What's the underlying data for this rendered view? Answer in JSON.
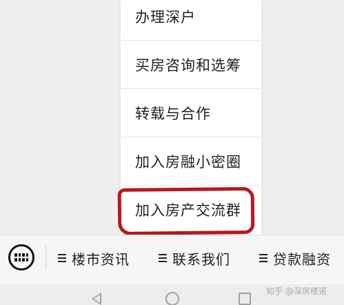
{
  "menu": {
    "items": [
      {
        "label": "办理深户"
      },
      {
        "label": "买房咨询和选筹"
      },
      {
        "label": "转载与合作"
      },
      {
        "label": "加入房融小密圈"
      },
      {
        "label": "加入房产交流群",
        "highlighted": true
      }
    ],
    "highlight_color": "#b7191b"
  },
  "bottom_bar": {
    "keyboard_icon": "keyboard-icon",
    "tabs": [
      {
        "label": "楼市资讯",
        "icon": "menu-lines-icon"
      },
      {
        "label": "联系我们",
        "icon": "menu-lines-icon"
      },
      {
        "label": "贷款融资",
        "icon": "menu-lines-icon"
      }
    ]
  },
  "watermark": "知乎 @深房楼诺",
  "system_nav": {
    "back_icon": "back-triangle-icon",
    "home_icon": "home-circle-icon",
    "recent_icon": "recent-square-icon"
  }
}
